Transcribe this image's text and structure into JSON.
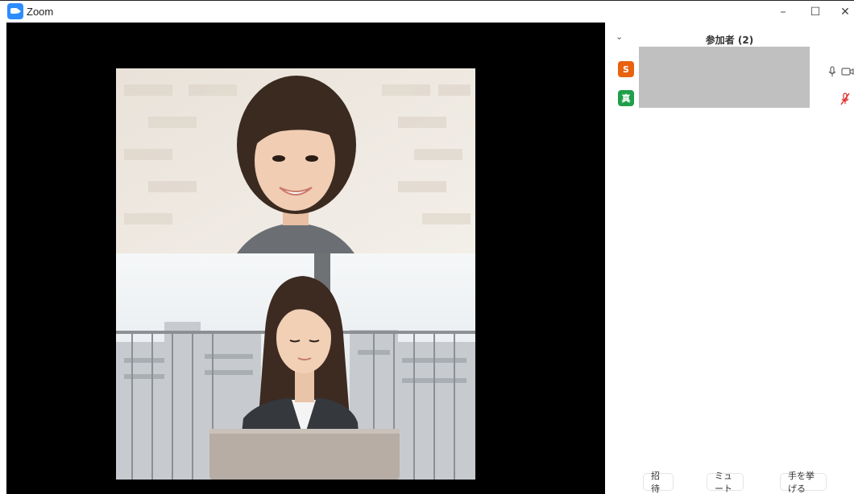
{
  "window": {
    "title": "Zoom",
    "controls": {
      "minimize": "–",
      "maximize": "☐",
      "close": "✕"
    }
  },
  "participants_panel": {
    "title": "参加者 (2)",
    "collapse_icon": "chevron-down-icon",
    "participants": [
      {
        "initial": "S",
        "avatar_color": "#e8620f",
        "mic": "on",
        "video": "on"
      },
      {
        "initial": "真",
        "avatar_color": "#1f9f4a",
        "mic": "muted",
        "video": "none"
      }
    ],
    "buttons": {
      "invite": "招待",
      "mute": "ミュート",
      "raise_hand": "手を挙げる"
    }
  },
  "colors": {
    "zoom_blue": "#2d8cff",
    "video_background": "#000000",
    "muted_red": "#e02828"
  }
}
